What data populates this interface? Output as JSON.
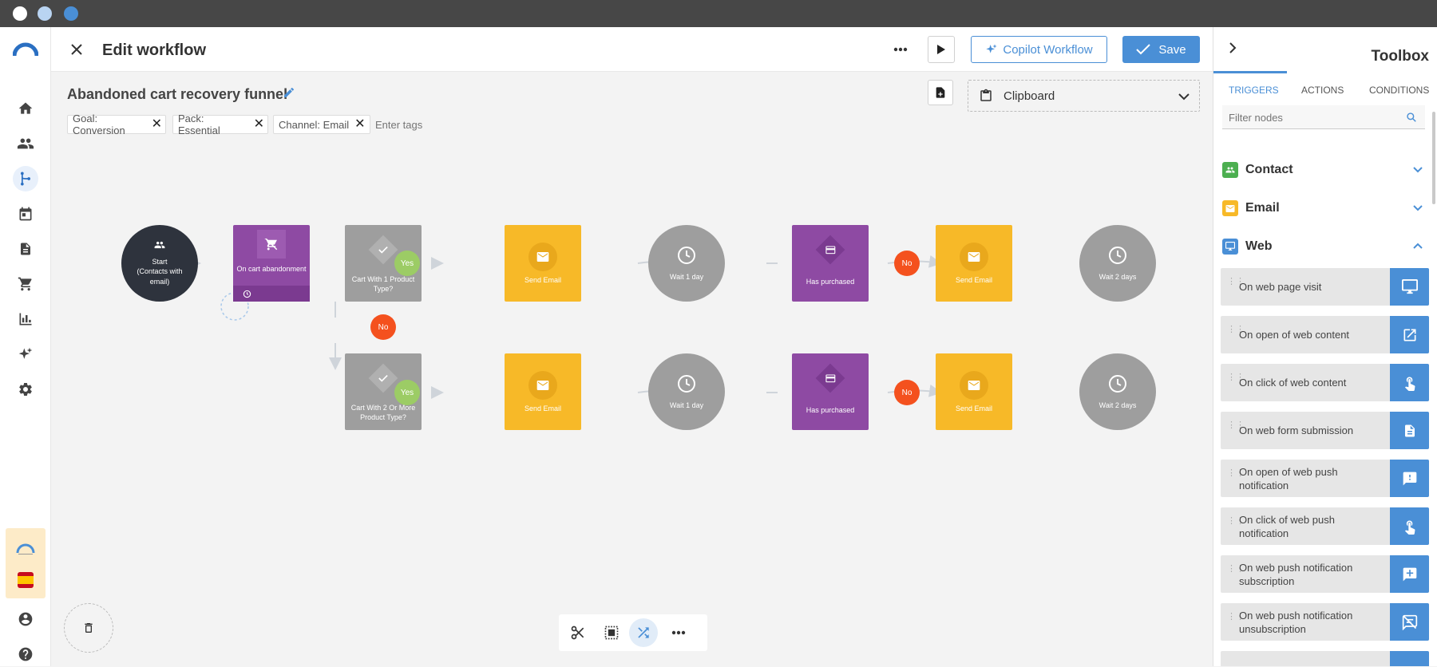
{
  "header": {
    "title": "Edit workflow",
    "copilot_label": "Copilot Workflow",
    "save_label": "Save"
  },
  "workflow": {
    "name": "Abandoned cart recovery funnel",
    "tags": [
      "Goal: Conversion",
      "Pack: Essential",
      "Channel: Email"
    ],
    "tags_placeholder": "Enter tags",
    "clipboard_label": "Clipboard"
  },
  "nodes": {
    "start_line1": "Start",
    "start_line2": "(Contacts with",
    "start_line3": "email)",
    "trigger": "On cart abandonment",
    "cond1_line1": "Cart With 1 Product",
    "cond1_line2": "Type?",
    "cond2_line1": "Cart With 2 Or More",
    "cond2_line2": "Product Type?",
    "send_email": "Send Email",
    "wait_1_day": "Wait 1 day",
    "has_purchased": "Has purchased",
    "wait_2_days": "Wait 2 days",
    "yes": "Yes",
    "no": "No"
  },
  "toolbox": {
    "title": "Toolbox",
    "tabs": [
      "TRIGGERS",
      "ACTIONS",
      "CONDITIONS"
    ],
    "filter_placeholder": "Filter nodes",
    "categories": [
      {
        "label": "Contact",
        "icon": "contacts-icon",
        "color": "#4caf50"
      },
      {
        "label": "Email",
        "icon": "email-icon",
        "color": "#f7b928"
      },
      {
        "label": "Web",
        "icon": "monitor-icon",
        "color": "#4a8fd6"
      }
    ],
    "items": [
      {
        "label": "On web page visit",
        "icon": "monitor-icon"
      },
      {
        "label": "On open of web content",
        "icon": "open-external-icon"
      },
      {
        "label": "On click of web content",
        "icon": "touch-icon"
      },
      {
        "label": "On web form submission",
        "icon": "document-icon"
      },
      {
        "label": "On open of web push notification",
        "icon": "alert-message-icon"
      },
      {
        "label": "On click of web push notification",
        "icon": "touch-icon"
      },
      {
        "label": "On web push notification subscription",
        "icon": "add-comment-icon"
      },
      {
        "label": "On web push notification unsubscription",
        "icon": "comments-disabled-icon"
      }
    ]
  },
  "colors": {
    "brand_blue": "#4a8fd6",
    "purple": "#8e4aa3",
    "yellow": "#f7b928",
    "gray_node": "#9e9e9e",
    "dark_node": "#2e333d",
    "yes_green": "#9ccc65",
    "no_red": "#f4511e"
  }
}
